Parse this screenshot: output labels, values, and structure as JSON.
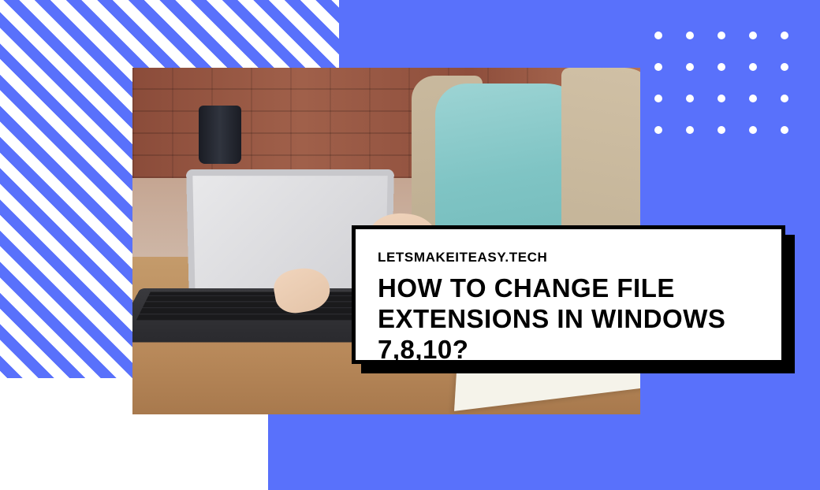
{
  "card": {
    "site": "LETSMAKEITEASY.TECH",
    "title": "HOW TO CHANGE FILE EXTENSIONS IN WINDOWS 7,8,10?"
  },
  "colors": {
    "accent": "#5971fb",
    "card_border": "#000000",
    "card_bg": "#ffffff"
  },
  "decor": {
    "dot_rows": 4,
    "dot_cols": 5
  }
}
